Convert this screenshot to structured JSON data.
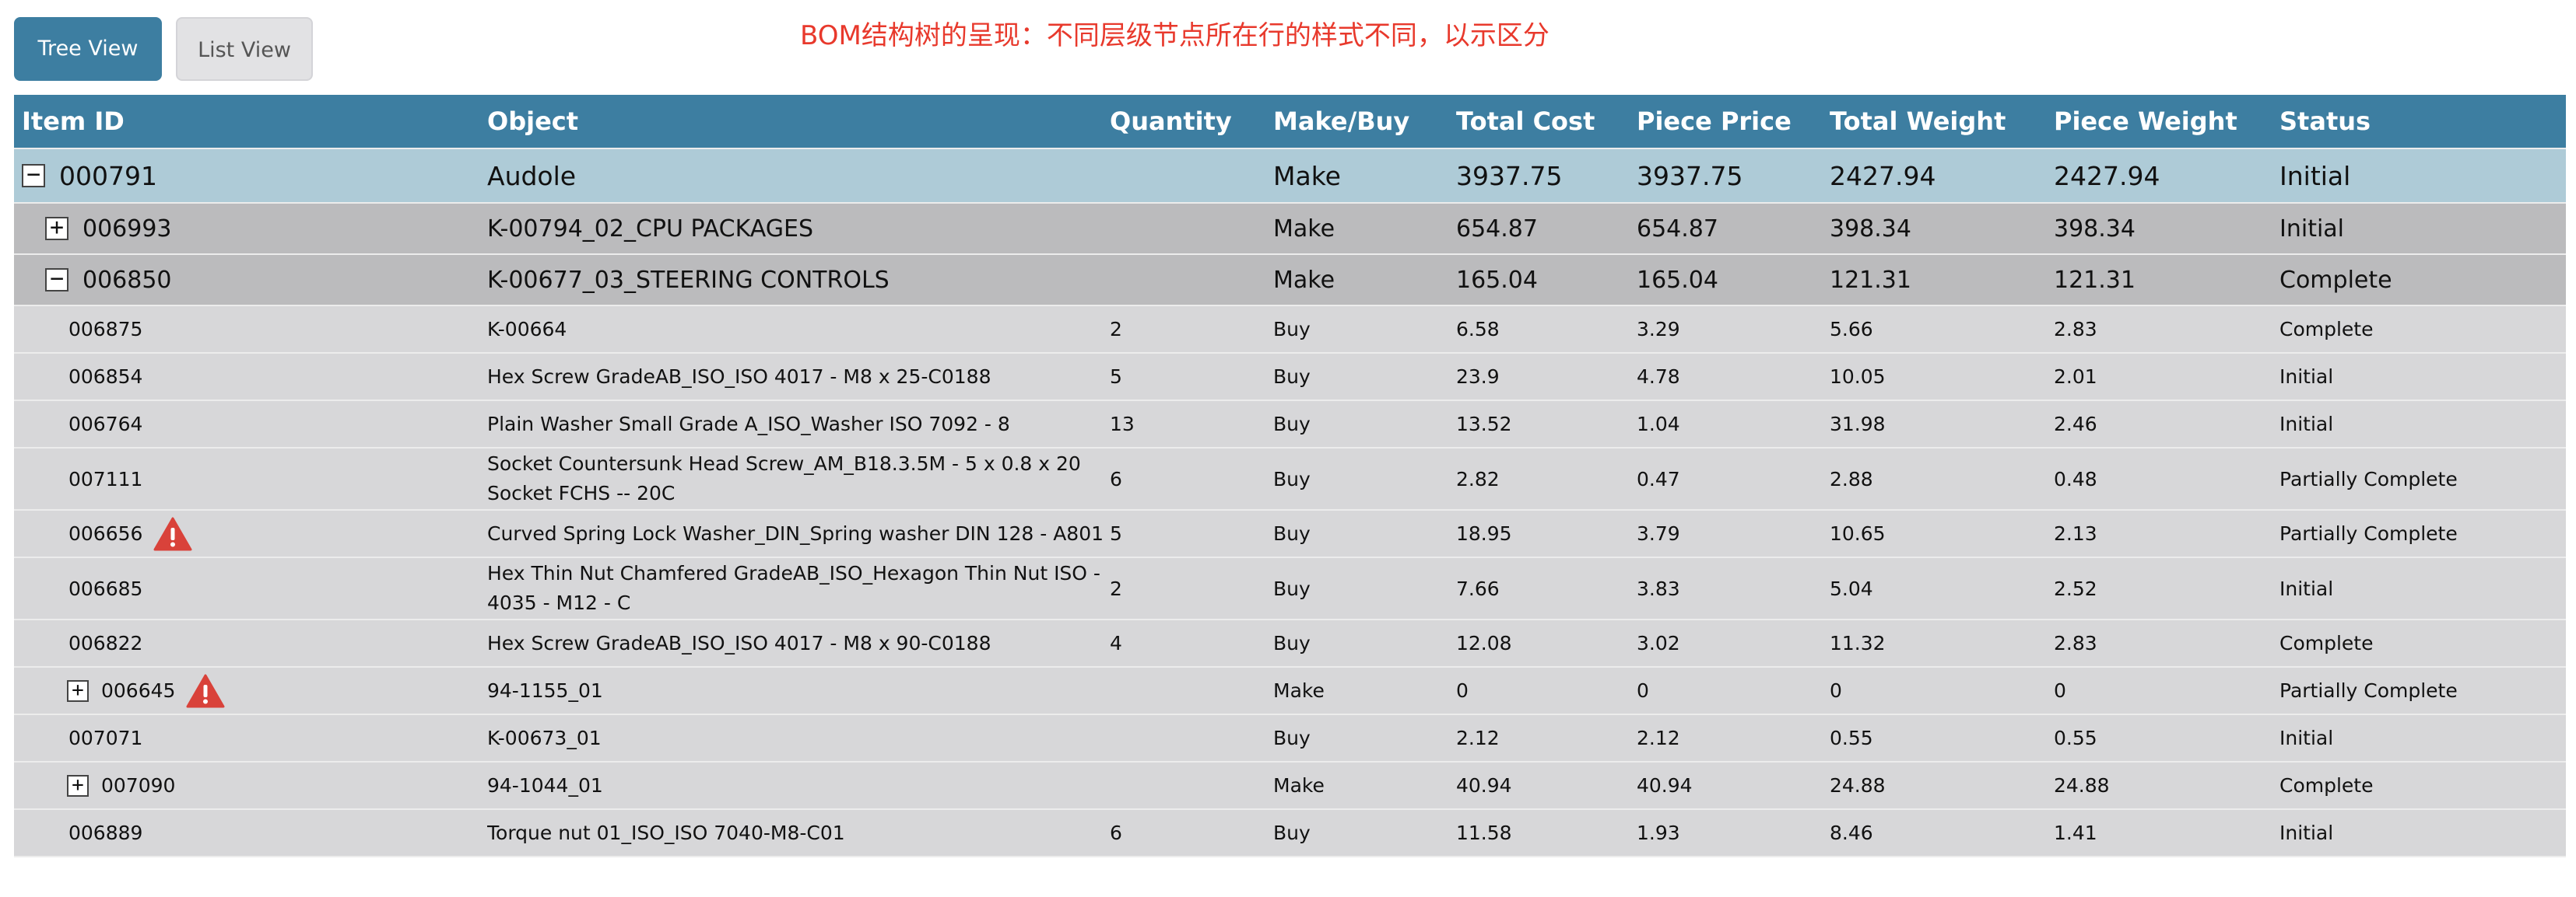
{
  "toolbar": {
    "tree_view": "Tree View",
    "list_view": "List View"
  },
  "note": "BOM结构树的呈现：不同层级节点所在行的样式不同，以示区分",
  "columns": [
    "Item ID",
    "Object",
    "Quantity",
    "Make/Buy",
    "Total Cost",
    "Piece Price",
    "Total Weight",
    "Piece Weight",
    "Status"
  ],
  "rows": [
    {
      "level": 0,
      "toggle": "−",
      "warn": false,
      "tall": false,
      "cells": [
        "000791",
        "Audole",
        "",
        "Make",
        "3937.75",
        "3937.75",
        "2427.94",
        "2427.94",
        "Initial"
      ]
    },
    {
      "level": 1,
      "toggle": "+",
      "warn": false,
      "tall": false,
      "cells": [
        "006993",
        "K-00794_02_CPU PACKAGES",
        "",
        "Make",
        "654.87",
        "654.87",
        "398.34",
        "398.34",
        "Initial"
      ]
    },
    {
      "level": 1,
      "toggle": "−",
      "warn": false,
      "tall": false,
      "cells": [
        "006850",
        "K-00677_03_STEERING CONTROLS",
        "",
        "Make",
        "165.04",
        "165.04",
        "121.31",
        "121.31",
        "Complete"
      ]
    },
    {
      "level": 2,
      "toggle": "",
      "warn": false,
      "tall": false,
      "cells": [
        "006875",
        "K-00664",
        "2",
        "Buy",
        "6.58",
        "3.29",
        "5.66",
        "2.83",
        "Complete"
      ]
    },
    {
      "level": 2,
      "toggle": "",
      "warn": false,
      "tall": false,
      "cells": [
        "006854",
        "Hex Screw GradeAB_ISO_ISO 4017 - M8 x 25-C0188",
        "5",
        "Buy",
        "23.9",
        "4.78",
        "10.05",
        "2.01",
        "Initial"
      ]
    },
    {
      "level": 2,
      "toggle": "",
      "warn": false,
      "tall": false,
      "cells": [
        "006764",
        "Plain Washer Small Grade A_ISO_Washer ISO 7092 - 8",
        "13",
        "Buy",
        "13.52",
        "1.04",
        "31.98",
        "2.46",
        "Initial"
      ]
    },
    {
      "level": 2,
      "toggle": "",
      "warn": false,
      "tall": true,
      "cells": [
        "007111",
        "Socket Countersunk Head Screw_AM_B18.3.5M - 5 x 0.8 x 20 Socket FCHS -- 20C",
        "6",
        "Buy",
        "2.82",
        "0.47",
        "2.88",
        "0.48",
        "Partially Complete"
      ]
    },
    {
      "level": 2,
      "toggle": "",
      "warn": true,
      "tall": false,
      "cells": [
        "006656",
        "Curved Spring Lock Washer_DIN_Spring washer DIN 128 - A801",
        "5",
        "Buy",
        "18.95",
        "3.79",
        "10.65",
        "2.13",
        "Partially Complete"
      ]
    },
    {
      "level": 2,
      "toggle": "",
      "warn": false,
      "tall": true,
      "cells": [
        "006685",
        "Hex Thin Nut Chamfered GradeAB_ISO_Hexagon Thin Nut ISO - 4035 - M12 - C",
        "2",
        "Buy",
        "7.66",
        "3.83",
        "5.04",
        "2.52",
        "Initial"
      ]
    },
    {
      "level": 2,
      "toggle": "",
      "warn": false,
      "tall": false,
      "cells": [
        "006822",
        "Hex Screw GradeAB_ISO_ISO 4017 - M8 x 90-C0188",
        "4",
        "Buy",
        "12.08",
        "3.02",
        "11.32",
        "2.83",
        "Complete"
      ]
    },
    {
      "level": 2,
      "toggle": "+",
      "warn": true,
      "tall": false,
      "cells": [
        "006645",
        "94-1155_01",
        "",
        "Make",
        "0",
        "0",
        "0",
        "0",
        "Partially Complete"
      ]
    },
    {
      "level": 2,
      "toggle": "",
      "warn": false,
      "tall": false,
      "cells": [
        "007071",
        "K-00673_01",
        "",
        "Buy",
        "2.12",
        "2.12",
        "0.55",
        "0.55",
        "Initial"
      ]
    },
    {
      "level": 2,
      "toggle": "+",
      "warn": false,
      "tall": false,
      "cells": [
        "007090",
        "94-1044_01",
        "",
        "Make",
        "40.94",
        "40.94",
        "24.88",
        "24.88",
        "Complete"
      ]
    },
    {
      "level": 2,
      "toggle": "",
      "warn": false,
      "tall": false,
      "cells": [
        "006889",
        "Torque nut 01_ISO_ISO 7040-M8-C01",
        "6",
        "Buy",
        "11.58",
        "1.93",
        "8.46",
        "1.41",
        "Initial"
      ]
    }
  ],
  "colors": {
    "header": "#3d7ea1",
    "level0": "#aecbd7",
    "level1": "#bbbbbd",
    "level2": "#d7d7d9",
    "note": "#e8392c",
    "warning": "#d9423a"
  },
  "icons": {
    "warning": "warning-icon",
    "expand": "expand-icon",
    "collapse": "collapse-icon"
  }
}
